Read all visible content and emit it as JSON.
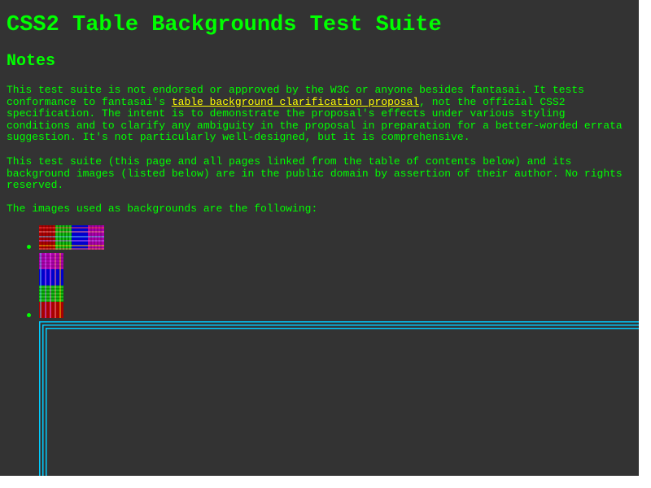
{
  "page": {
    "title": "CSS2 Table Backgrounds Test Suite",
    "notes_heading": "Notes",
    "para1_before": "This test suite is not endorsed or approved by the W3C or anyone besides fantasai. It tests conformance to fantasai's ",
    "para1_link": "table background clarification proposal",
    "para1_after": ", not the official CSS2 specification. The intent is to demonstrate the proposal's effects under various styling conditions and to clarify any ambiguity in the proposal in preparation for a better-worded errata suggestion. It's not particularly well-designed, but it is comprehensive.",
    "para2": "This test suite (this page and all pages linked from the table of contents below) and its background images (listed below) are in the public domain by assertion of their author. No rights reserved.",
    "para3": "The images used as backgrounds are the following:"
  },
  "colors": {
    "background": "#333333",
    "text": "#00ff00",
    "link": "#ffff00",
    "table_border": "#00ccff"
  },
  "images": [
    {
      "name": "horizontal-stripes-image"
    },
    {
      "name": "vertical-stripes-image"
    }
  ]
}
